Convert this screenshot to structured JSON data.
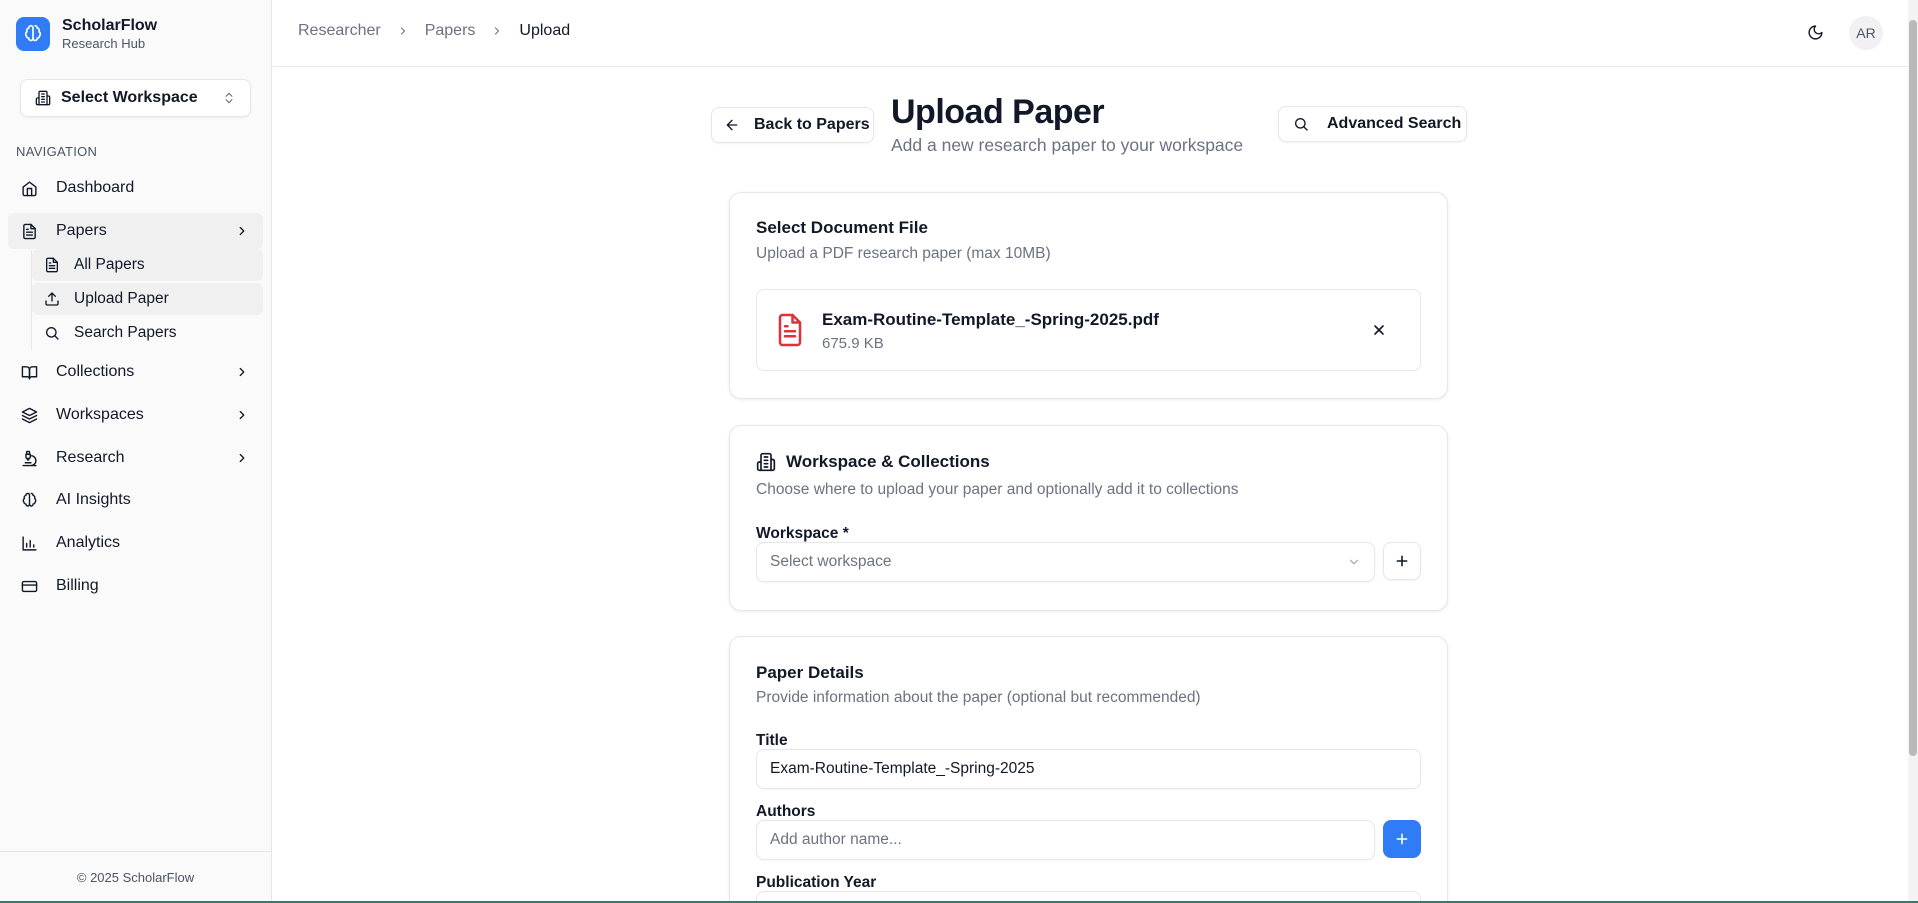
{
  "brand": {
    "name": "ScholarFlow",
    "subtitle": "Research Hub"
  },
  "workspace_selector": {
    "label": "Select Workspace"
  },
  "sidebar": {
    "section_title": "NAVIGATION",
    "items": [
      {
        "label": "Dashboard",
        "icon": "home-icon"
      },
      {
        "label": "Papers",
        "icon": "file-text-icon",
        "expanded": true
      },
      {
        "label": "Collections",
        "icon": "book-open-icon"
      },
      {
        "label": "Workspaces",
        "icon": "layers-icon"
      },
      {
        "label": "Research",
        "icon": "microscope-icon"
      },
      {
        "label": "AI Insights",
        "icon": "brain-icon"
      },
      {
        "label": "Analytics",
        "icon": "bar-chart-icon"
      },
      {
        "label": "Billing",
        "icon": "credit-card-icon"
      }
    ],
    "papers_sub": [
      {
        "label": "All Papers",
        "icon": "file-text-icon"
      },
      {
        "label": "Upload Paper",
        "icon": "upload-icon"
      },
      {
        "label": "Search Papers",
        "icon": "search-icon"
      }
    ],
    "footer": "© 2025 ScholarFlow"
  },
  "breadcrumb": [
    "Researcher",
    "Papers",
    "Upload"
  ],
  "user": {
    "initials": "AR"
  },
  "page": {
    "back_label": "Back to Papers",
    "title": "Upload Paper",
    "subtitle": "Add a new research paper to your workspace",
    "advanced_search_label": "Advanced Search"
  },
  "file_card": {
    "title": "Select Document File",
    "description": "Upload a PDF research paper (max 10MB)",
    "file_name": "Exam-Routine-Template_-Spring-2025.pdf",
    "file_size": "675.9 KB"
  },
  "workspace_card": {
    "title": "Workspace & Collections",
    "description": "Choose where to upload your paper and optionally add it to collections",
    "workspace_label": "Workspace *",
    "workspace_placeholder": "Select workspace"
  },
  "details_card": {
    "title": "Paper Details",
    "description": "Provide information about the paper (optional but recommended)",
    "title_label": "Title",
    "title_value": "Exam-Routine-Template_-Spring-2025",
    "authors_label": "Authors",
    "authors_placeholder": "Add author name...",
    "year_label": "Publication Year"
  },
  "colors": {
    "primary": "#2f7cf6",
    "pdf_icon": "#e0313a",
    "sidebar_bg": "#fafafa"
  }
}
